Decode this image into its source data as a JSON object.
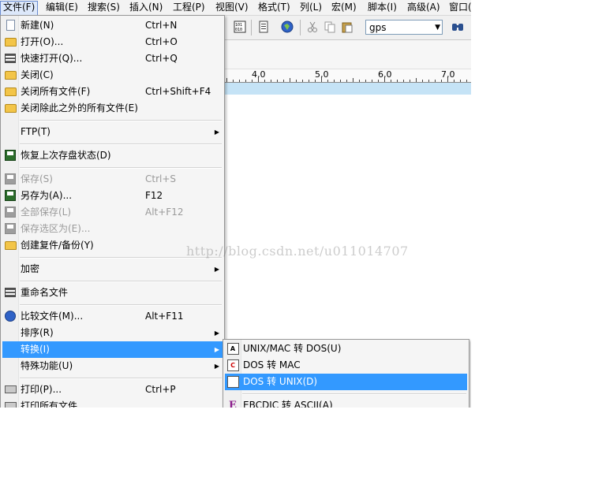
{
  "menubar": {
    "items": [
      "文件(F)",
      "编辑(E)",
      "搜索(S)",
      "插入(N)",
      "工程(P)",
      "视图(V)",
      "格式(T)",
      "列(L)",
      "宏(M)",
      "脚本(I)",
      "高级(A)",
      "窗口("
    ]
  },
  "toolbar": {
    "search_combo_value": "gps",
    "icons": [
      "hex-icon",
      "file-list-icon",
      "globe-icon",
      "cut-icon",
      "copy-icon",
      "paste-icon",
      "find-icon"
    ]
  },
  "ruler": {
    "labels": [
      "4,0",
      "5,0",
      "6,0",
      "7,0"
    ]
  },
  "file_menu": {
    "items": [
      {
        "label": "新建(N)",
        "shortcut": "Ctrl+N",
        "icon": "new-file-icon"
      },
      {
        "label": "打开(O)...",
        "shortcut": "Ctrl+O",
        "icon": "open-folder-icon"
      },
      {
        "label": "快速打开(Q)...",
        "shortcut": "Ctrl+Q",
        "icon": "quick-open-icon"
      },
      {
        "label": "关闭(C)",
        "shortcut": "",
        "icon": "close-folder-icon"
      },
      {
        "label": "关闭所有文件(F)",
        "shortcut": "Ctrl+Shift+F4",
        "icon": "close-all-icon"
      },
      {
        "label": "关闭除此之外的所有文件(E)",
        "shortcut": "",
        "icon": "close-others-icon"
      },
      {
        "label": "FTP(T)",
        "shortcut": "",
        "submenu": true
      },
      {
        "label": "恢复上次存盘状态(D)",
        "shortcut": "",
        "icon": "revert-icon"
      },
      {
        "label": "保存(S)",
        "shortcut": "Ctrl+S",
        "icon": "save-icon",
        "disabled": true
      },
      {
        "label": "另存为(A)...",
        "shortcut": "F12",
        "icon": "save-as-icon"
      },
      {
        "label": "全部保存(L)",
        "shortcut": "Alt+F12",
        "icon": "save-all-icon",
        "disabled": true
      },
      {
        "label": "保存选区为(E)...",
        "shortcut": "",
        "icon": "save-selection-icon",
        "disabled": true
      },
      {
        "label": "创建复件/备份(Y)",
        "shortcut": "",
        "icon": "backup-icon"
      },
      {
        "label": "加密",
        "shortcut": "",
        "submenu": true
      },
      {
        "label": "重命名文件",
        "shortcut": "",
        "icon": "rename-icon"
      },
      {
        "label": "比较文件(M)...",
        "shortcut": "Alt+F11",
        "icon": "compare-icon"
      },
      {
        "label": "排序(R)",
        "shortcut": "",
        "submenu": true
      },
      {
        "label": "转换(I)",
        "shortcut": "",
        "submenu": true,
        "highlighted": true
      },
      {
        "label": "特殊功能(U)",
        "shortcut": "",
        "submenu": true
      },
      {
        "label": "打印(P)...",
        "shortcut": "Ctrl+P",
        "icon": "print-icon"
      },
      {
        "label": "打印所有文件",
        "shortcut": "",
        "icon": "print-all-icon"
      }
    ]
  },
  "convert_submenu": {
    "items": [
      {
        "label": "UNIX/MAC 转 DOS(U)",
        "icon": "unix-to-dos-icon"
      },
      {
        "label": "DOS 转 MAC",
        "icon": "dos-to-mac-icon"
      },
      {
        "label": "DOS 转 UNIX(D)",
        "icon": "dos-to-unix-icon",
        "highlighted": true
      },
      {
        "label": "EBCDIC 转 ASCII(A)",
        "icon": "ebcdic-icon"
      }
    ]
  },
  "watermark": "http://blog.csdn.net/u011014707",
  "colors": {
    "highlight": "#3399ff",
    "current_line": "#c5e3f6"
  }
}
